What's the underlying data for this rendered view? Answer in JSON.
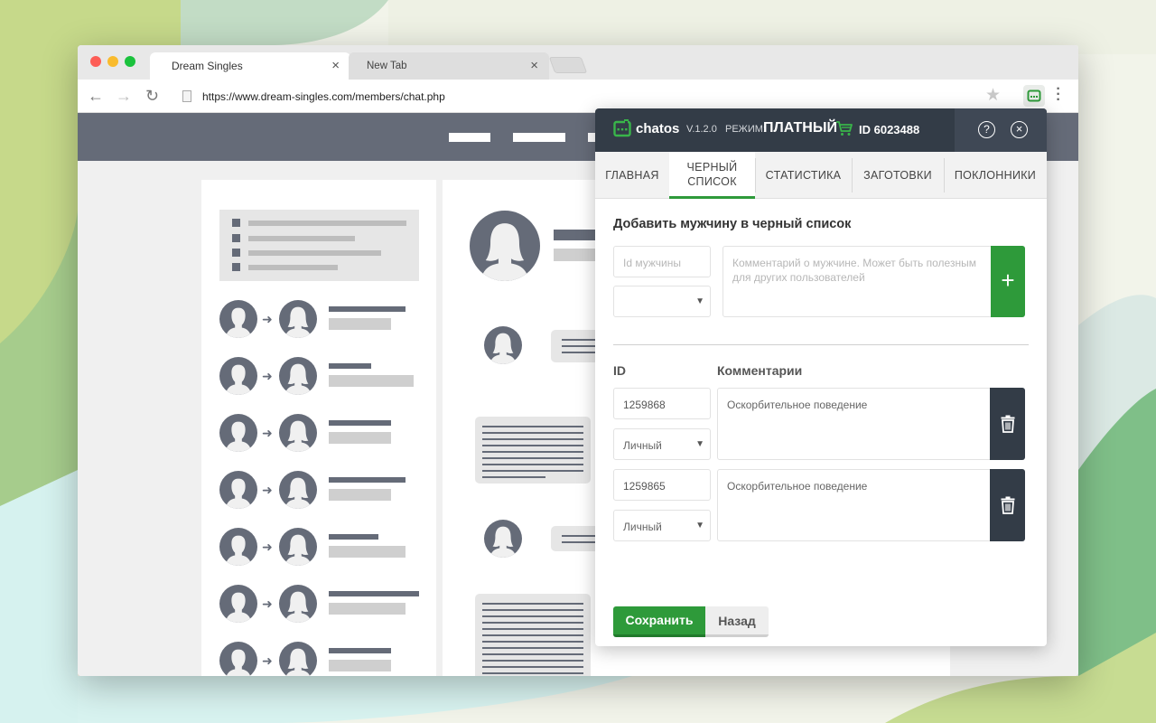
{
  "browser": {
    "tabs": [
      {
        "title": "Dream Singles",
        "active": true
      },
      {
        "title": "New Tab",
        "active": false
      }
    ],
    "url": "https://www.dream-singles.com/members/chat.php",
    "icons": {
      "back": "arrow-left-icon",
      "forward": "arrow-right-icon",
      "reload": "reload-icon",
      "bookmark": "star-icon",
      "extension": "chatos-extension-icon",
      "menu": "more-vertical-icon"
    }
  },
  "popup": {
    "brand": "chatos",
    "version": "V.1.2.0",
    "mode_label": "РЕЖИМ:",
    "mode_value": "ПЛАТНЫЙ",
    "user_id": "ID 6023488",
    "tabs": [
      {
        "label": "ГЛАВНАЯ",
        "active": false
      },
      {
        "label": "ЧЕРНЫЙ СПИСОК",
        "active": true
      },
      {
        "label": "СТАТИСТИКА",
        "active": false
      },
      {
        "label": "ЗАГОТОВКИ",
        "active": false
      },
      {
        "label": "ПОКЛОННИКИ",
        "active": false
      }
    ],
    "add_section": {
      "title": "Добавить мужчину в черный список",
      "id_placeholder": "Id мужчины",
      "type_value": "",
      "comment_placeholder": "Комментарий о мужчине. Может быть полезным для других пользователей",
      "add_label": "+"
    },
    "list": {
      "col_id": "ID",
      "col_comments": "Комментарии",
      "rows": [
        {
          "id": "1259868",
          "type": "Личный",
          "comment": "Оскорбительное поведение"
        },
        {
          "id": "1259865",
          "type": "Личный",
          "comment": "Оскорбительное поведение"
        }
      ]
    },
    "save_label": "Сохранить",
    "back_label": "Назад",
    "colors": {
      "header": "#333c47",
      "accent": "#2e9a3a",
      "delete": "#333c47"
    }
  }
}
